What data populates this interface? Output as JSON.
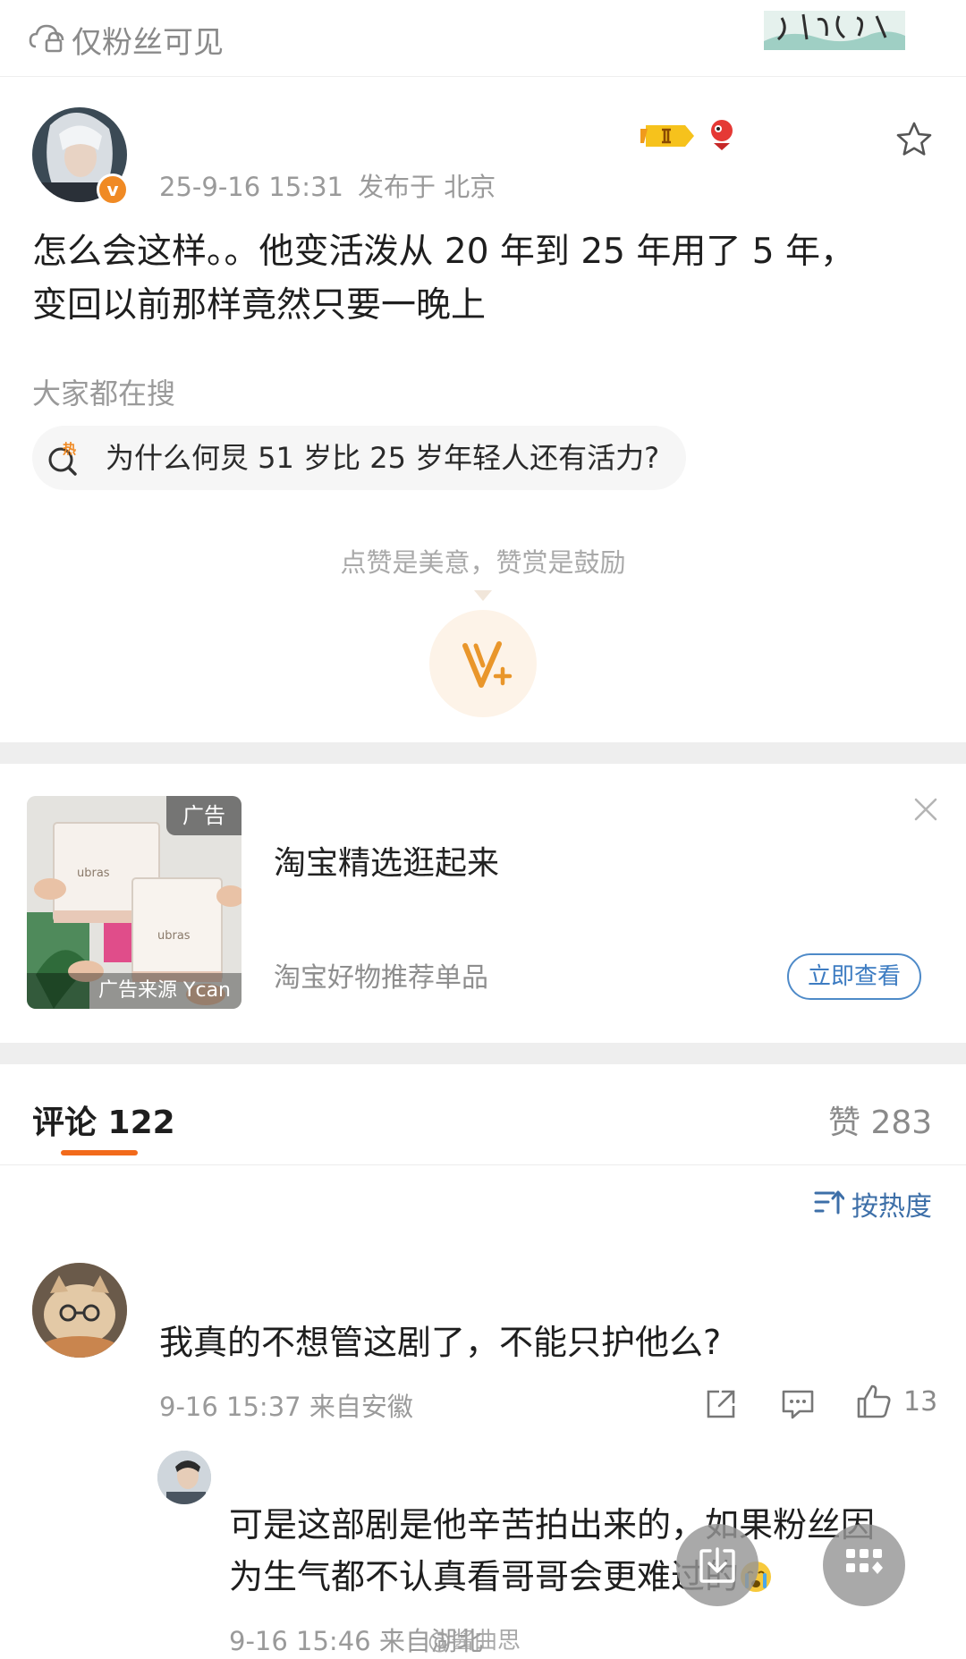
{
  "top_bar": {
    "visibility_label": "仅粉丝可见",
    "visibility_icon": "lock-cloud-icon",
    "brand_logo_text": "赴山海之约"
  },
  "post": {
    "verified_badge": "v",
    "timestamp": "25-9-16 15:31",
    "location": "发布于 北京",
    "text_line1": "怎么会这样。。他变活泼从 20 年到 25 年用了 5 年，",
    "text_line2": "变回以前那样竟然只要一晚上",
    "hot_search_title": "大家都在搜",
    "hot_search_query": "为什么何炅 51 岁比 25 岁年轻人还有活力?",
    "hot_search_icon_label": "热",
    "reward_caption": "点赞是美意，赞赏是鼓励"
  },
  "ad": {
    "tag": "广告",
    "source": "广告来源 Ycan",
    "brand_print": "ubras",
    "title": "淘宝精选逛起来",
    "description": "淘宝好物推荐单品",
    "button_label": "立即查看"
  },
  "comments_header": {
    "comments_tab": "评论 122",
    "likes_tab": "赞 283",
    "sort_label": "按热度"
  },
  "comments": [
    {
      "text": "我真的不想管这剧了，不能只护他么?",
      "meta": "9-16 15:37 来自安徽",
      "like_count": "13"
    }
  ],
  "reply": {
    "text_line1": "可是这部剧是他辛苦拍出来的，如果粉丝因",
    "text_line2": "为生气都不认真看哥哥会更难过的",
    "meta": "9-16 15:46 来自湖北"
  },
  "watermark": "@酱曲思",
  "colors": {
    "accent_orange": "#f26a1b",
    "link_blue": "#3d6fa8",
    "meta_gray": "#9a9a9a",
    "section_gap": "#eeeeee"
  }
}
